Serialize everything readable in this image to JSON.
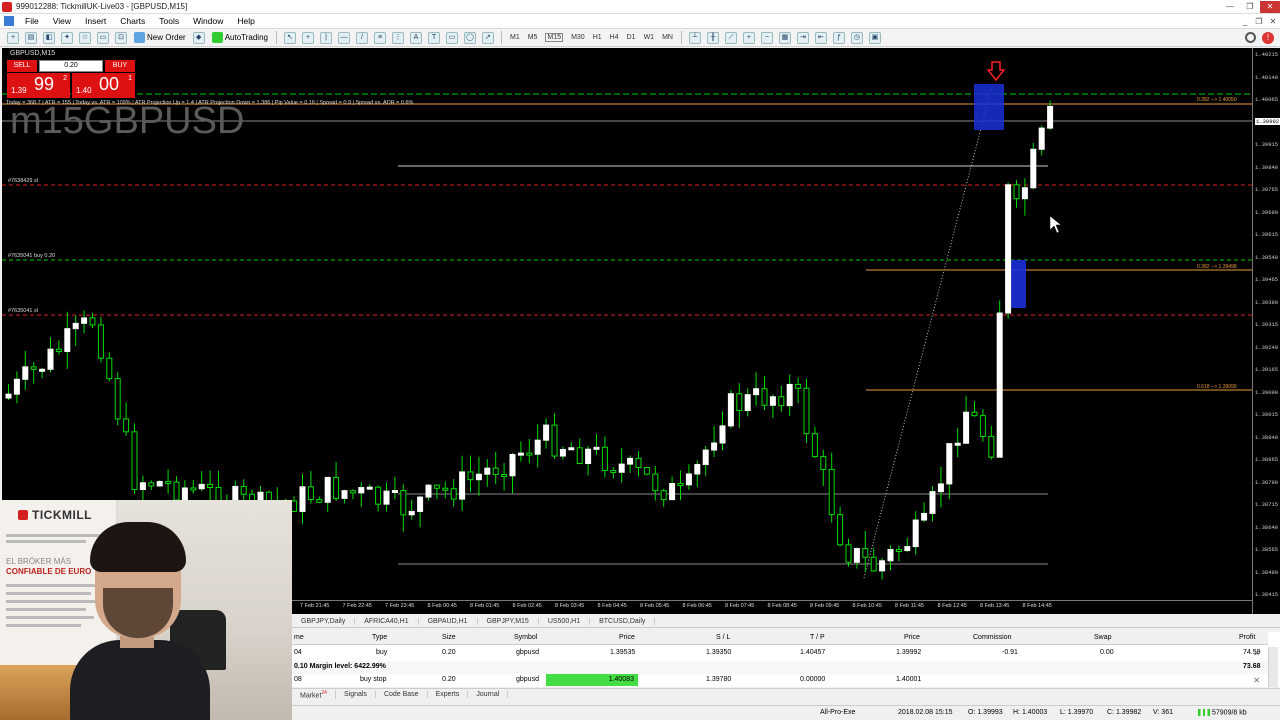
{
  "window": {
    "title": "999012288: TickmillUK-Live03 - [GBPUSD,M15]"
  },
  "menu": [
    "File",
    "View",
    "Insert",
    "Charts",
    "Tools",
    "Window",
    "Help"
  ],
  "toolbar": {
    "new_order": "New Order",
    "autotrading": "AutoTrading",
    "timeframes": [
      "M1",
      "M5",
      "M15",
      "M30",
      "H1",
      "H4",
      "D1",
      "W1",
      "MN"
    ]
  },
  "chart": {
    "title": "GBPUSD,M15",
    "watermark": "m15GBPUSD",
    "one_click": {
      "sell": "SELL",
      "buy": "BUY",
      "lot": "0.20",
      "bid_small": "1.39",
      "bid_big": "99",
      "bid_sup": "2",
      "ask_small": "1.40",
      "ask_big": "00",
      "ask_sup": "1"
    },
    "info_bar": "Today = 368.7  |  ATR = 155  |  Today vs. ATR = 109%  |  ATR Projection Up = 1.4  |  ATR Projection Down = 1.386  |  Pip Value = 0.16  |  Spread = 0.9  |  Spread vs. ADR = 0.6%",
    "order_labels": [
      "#7638429 sl",
      "#7635041 buy 0.20",
      "#7635041 sl"
    ],
    "fib_labels": [
      "0.382 --> 1.40050",
      "0.382 --> 1.39498",
      "0.618 --> 1.39099"
    ],
    "price_ticks": [
      "1.40215",
      "1.40140",
      "1.40065",
      "1.39992",
      "1.39915",
      "1.39840",
      "1.39765",
      "1.39690",
      "1.39615",
      "1.39540",
      "1.39465",
      "1.39390",
      "1.39315",
      "1.39240",
      "1.39165",
      "1.39090",
      "1.39015",
      "1.38940",
      "1.38865",
      "1.38790",
      "1.38715",
      "1.38640",
      "1.38565",
      "1.38490",
      "1.38415"
    ],
    "time_ticks": [
      "7 Feb 21:45",
      "7 Feb 22:45",
      "7 Feb 23:45",
      "8 Feb 00:45",
      "8 Feb 01:45",
      "8 Feb 02:45",
      "8 Feb 03:45",
      "8 Feb 04:45",
      "8 Feb 05:45",
      "8 Feb 06:45",
      "8 Feb 07:45",
      "8 Feb 08:45",
      "8 Feb 09:45",
      "8 Feb 10:45",
      "8 Feb 11:45",
      "8 Feb 12:45",
      "8 Feb 13:45",
      "8 Feb 14:45"
    ]
  },
  "chart_tabs": [
    "GBPJPY,Daily",
    "AFRICA40,H1",
    "GBPAUD,H1",
    "GBPJPY,M15",
    "US500,H1",
    "BTCUSD,Daily"
  ],
  "terminal": {
    "headers": [
      "me",
      "Type",
      "Size",
      "Symbol",
      "Price",
      "S / L",
      "T / P",
      "Price",
      "Commission",
      "Swap",
      "Profit"
    ],
    "row1": [
      "04",
      "buy",
      "0.20",
      "gbpusd",
      "1.39535",
      "1.39350",
      "1.40457",
      "1.39992",
      "-0.91",
      "0.00",
      "74.59"
    ],
    "summary": {
      "left": "0.10  Margin level: 6422.99%",
      "profit": "73.68"
    },
    "row3": [
      "08",
      "buy stop",
      "0.20",
      "gbpusd",
      "1.40083",
      "1.39780",
      "0.00000",
      "1.40001"
    ]
  },
  "bottom_tabs": [
    "Market",
    "Signals",
    "Code Base",
    "Experts",
    "Journal"
  ],
  "market_badge": "24",
  "status": {
    "profile": "All-Pro-Exe",
    "datetime": "2018.02.08 15:15",
    "open": "O: 1.39993",
    "high": "H: 1.40003",
    "low": "L: 1.39970",
    "close": "C: 1.39982",
    "volume": "V: 361",
    "traffic": "57909/8 kb"
  },
  "webcam": {
    "logo": "TICKMILL",
    "line1": "EL BRÓKER MÁS",
    "line2": "CONFIABLE DE EURO"
  },
  "colors": {
    "bull": "#ffffff",
    "bear_outline": "#00dd00",
    "fib": "#e79a3d",
    "sl_line": "#dd2020",
    "order_line": "#00cc00",
    "zone": "#1a2fd6"
  }
}
